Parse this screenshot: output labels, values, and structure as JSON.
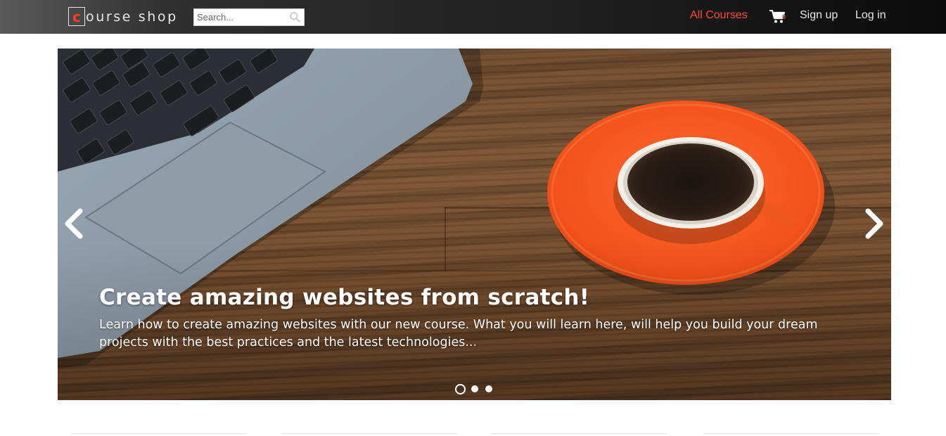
{
  "header": {
    "brand_letter": "c",
    "brand_rest": "ourse shop",
    "search_placeholder": "Search...",
    "nav": {
      "all_courses": "All Courses",
      "cart_count": "0",
      "signup": "Sign up",
      "login": "Log in"
    },
    "colors": {
      "accent": "#ff4a2a",
      "brand_box": "#ff3b1f"
    }
  },
  "carousel": {
    "title": "Create amazing websites from scratch!",
    "text": "Learn how to create amazing websites with our new course. What you will learn here, will help you build your dream projects with the best practices and the latest technologies...",
    "active_slide": 1,
    "slide_count": 3,
    "icons": {
      "prev": "chevron-left-icon",
      "next": "chevron-right-icon"
    }
  }
}
